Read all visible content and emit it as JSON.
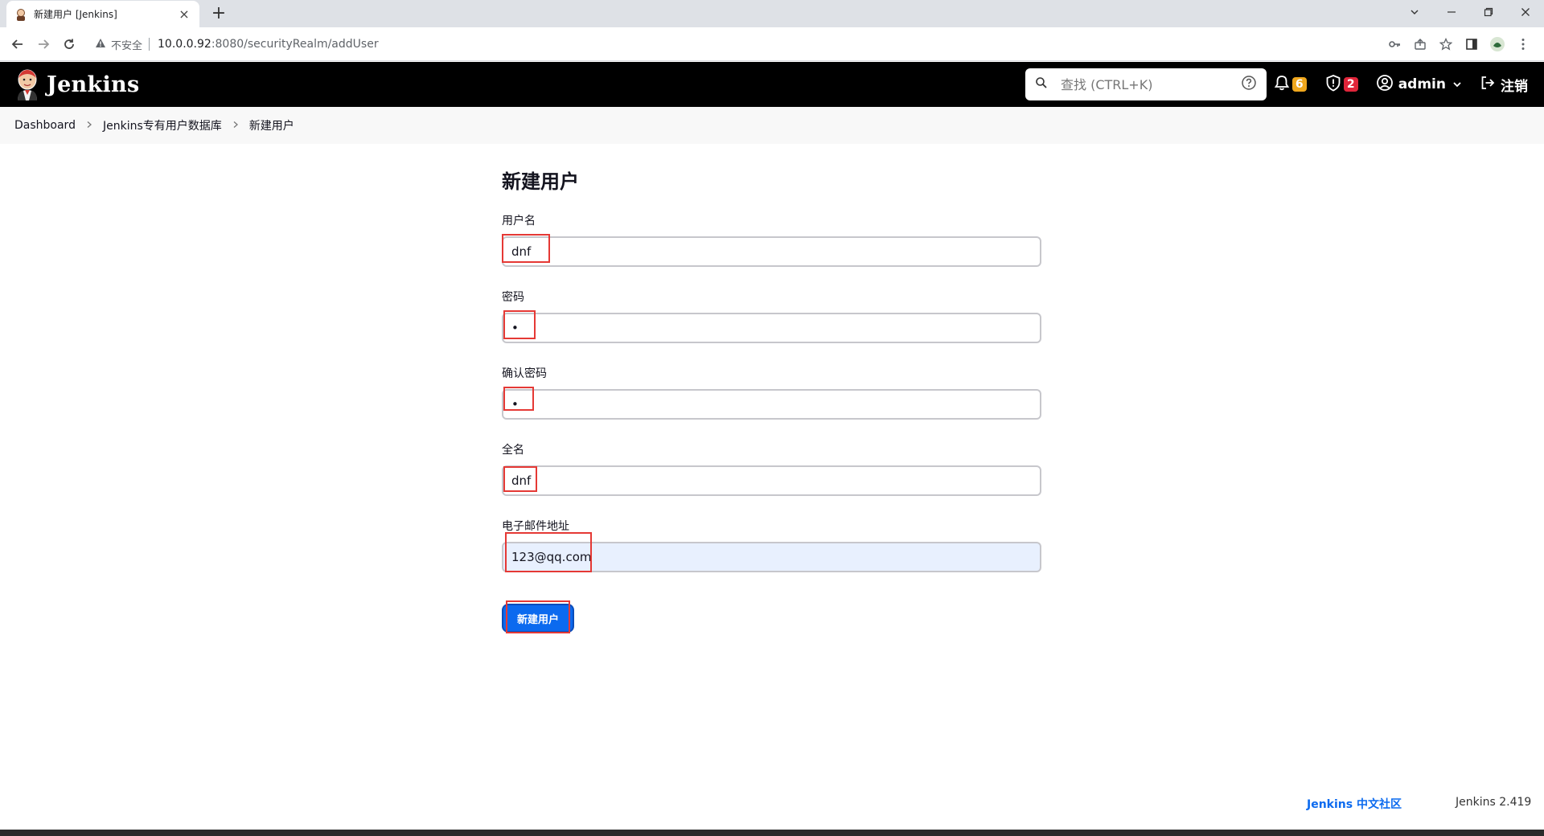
{
  "browser": {
    "tab_title": "新建用户 [Jenkins]",
    "tab_close": "×",
    "new_tab": "+",
    "security_label": "不安全",
    "url_host": "10.0.0.92",
    "url_rest": ":8080/securityRealm/addUser"
  },
  "header": {
    "brand": "Jenkins",
    "search_placeholder": "查找 (CTRL+K)",
    "notifications_count": "6",
    "security_count": "2",
    "user": "admin",
    "logout": "注销",
    "colors": {
      "notif_badge": "#f0a71d",
      "security_badge": "#e0253a"
    }
  },
  "breadcrumb": {
    "items": [
      "Dashboard",
      "Jenkins专有用户数据库",
      "新建用户"
    ]
  },
  "form": {
    "title": "新建用户",
    "username": {
      "label": "用户名",
      "value": "dnf"
    },
    "password": {
      "label": "密码",
      "value": "•"
    },
    "confirm_password": {
      "label": "确认密码",
      "value": "•"
    },
    "fullname": {
      "label": "全名",
      "value": "dnf"
    },
    "email": {
      "label": "电子邮件地址",
      "value": "123@qq.com"
    },
    "submit_label": "新建用户"
  },
  "footer": {
    "community": "Jenkins 中文社区",
    "version": "Jenkins 2.419"
  }
}
